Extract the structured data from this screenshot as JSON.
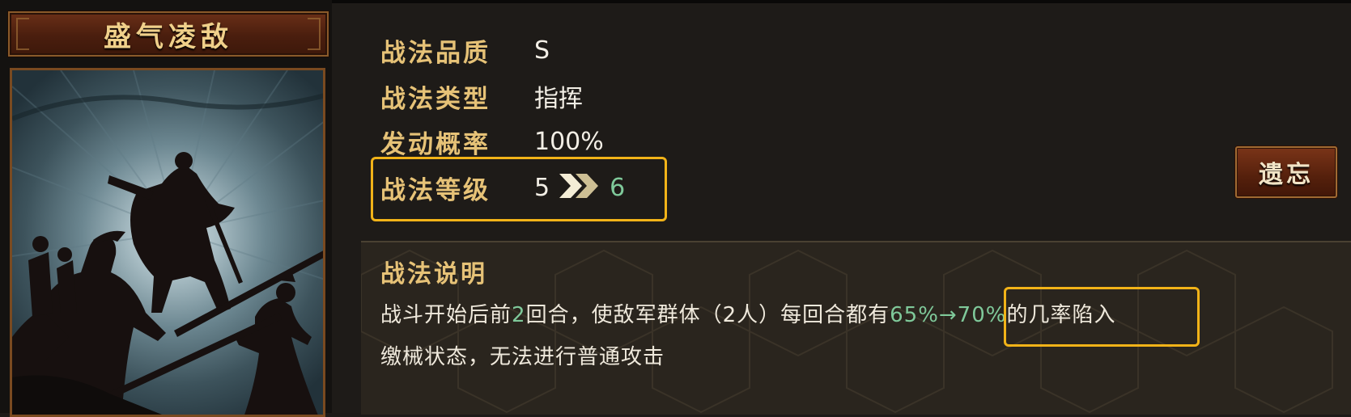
{
  "skill": {
    "name": "盛气凌敌"
  },
  "info": {
    "quality_label": "战法品质",
    "quality_value": "S",
    "type_label": "战法类型",
    "type_value": "指挥",
    "rate_label": "发动概率",
    "rate_value": "100%",
    "level_label": "战法等级",
    "level_current": "5",
    "level_next": "6"
  },
  "buttons": {
    "forget_label": "遗忘"
  },
  "description": {
    "title": "战法说明",
    "seg1": "战斗开始后前",
    "rounds": "2",
    "seg2": "回合，使敌军群体（2人）每回合都有",
    "chance": "65%→70%",
    "seg3": "的几率陷入",
    "line2": "缴械状态，无法进行普通攻击"
  },
  "colors": {
    "label_gold": "#e6c277",
    "value_white": "#f3efe6",
    "upgrade_green": "#7fc99a",
    "highlight_yellow": "#f2b318",
    "button_red": "#55200c"
  },
  "icons": {
    "upgrade_arrow": "double-chevron-right-icon"
  }
}
